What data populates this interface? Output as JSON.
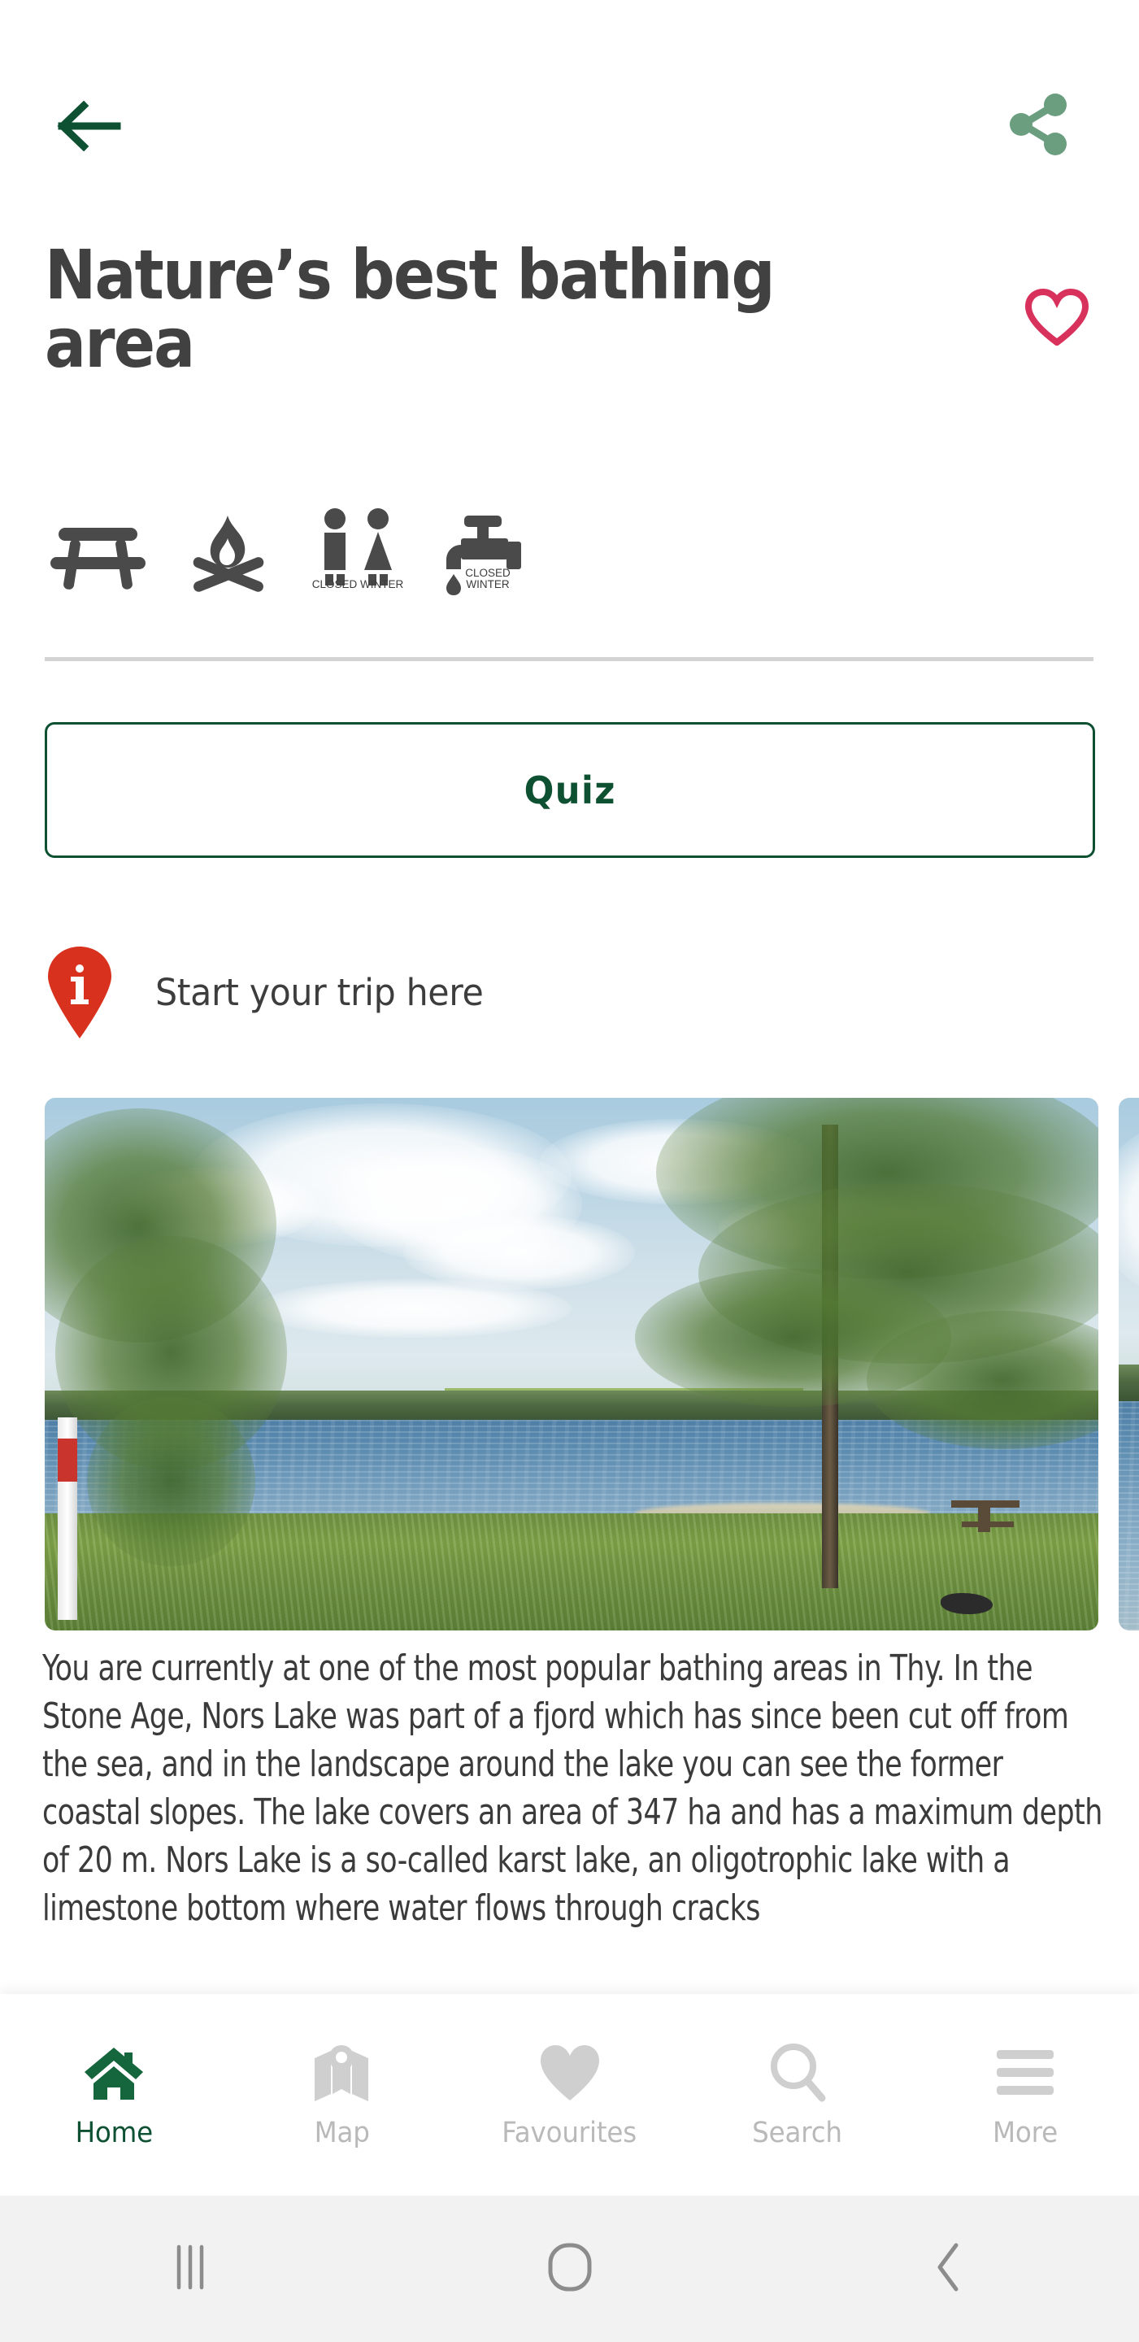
{
  "colors": {
    "brand_green": "#0d5032",
    "share_green": "#6a9e7f",
    "heart_red": "#d8315b",
    "pin_red": "#d8321f",
    "title_gray": "#414141",
    "body_gray": "#3b3b3b",
    "inactive_gray": "#b9b9b9",
    "divider_gray": "#d3d3d3",
    "sysnav_bg": "#f2f2f2"
  },
  "topbar": {
    "back_icon": "arrow-left-icon",
    "back_label": "Back",
    "share_icon": "share-icon",
    "share_label": "Share"
  },
  "header": {
    "title": "Nature’s best bathing area",
    "favourite_icon": "heart-outline-icon",
    "favourite_label": "Add to favourites"
  },
  "amenities": [
    {
      "icon": "picnic-table-icon",
      "label": "Picnic table",
      "note": ""
    },
    {
      "icon": "campfire-icon",
      "label": "Campfire site",
      "note": ""
    },
    {
      "icon": "toilets-icon",
      "label": "Toilets",
      "note": "CLOSED WINTER"
    },
    {
      "icon": "water-tap-icon",
      "label": "Drinking water",
      "note": "CLOSED WINTER"
    }
  ],
  "quiz": {
    "label": "Quiz"
  },
  "trip": {
    "pin_icon": "info-pin-icon",
    "pin_glyph": "i",
    "label": "Start your trip here"
  },
  "gallery": {
    "images": [
      {
        "alt": "Nors Lake shoreline with birch tree and grass"
      },
      {
        "alt": "Lake view with blossoming tree"
      }
    ]
  },
  "article": {
    "text": "You are currently at one of the most popular bathing areas in Thy. In the Stone Age, Nors Lake was part of a fjord which has since been cut off from the sea, and in the landscape around the lake you can see the former coastal slopes. The lake covers an area of 347 ha and has a maximum depth of 20 m. Nors Lake is a so-called karst lake, an oligotrophic lake with a limestone bottom where water flows through cracks"
  },
  "tabbar": {
    "items": [
      {
        "label": "Home",
        "icon": "home-icon",
        "active": true
      },
      {
        "label": "Map",
        "icon": "map-icon",
        "active": false
      },
      {
        "label": "Favourites",
        "icon": "heart-icon",
        "active": false
      },
      {
        "label": "Search",
        "icon": "search-icon",
        "active": false
      },
      {
        "label": "More",
        "icon": "hamburger-icon",
        "active": false
      }
    ]
  },
  "sysnav": {
    "recents_label": "Recent apps",
    "home_label": "Home",
    "back_label": "Back"
  }
}
